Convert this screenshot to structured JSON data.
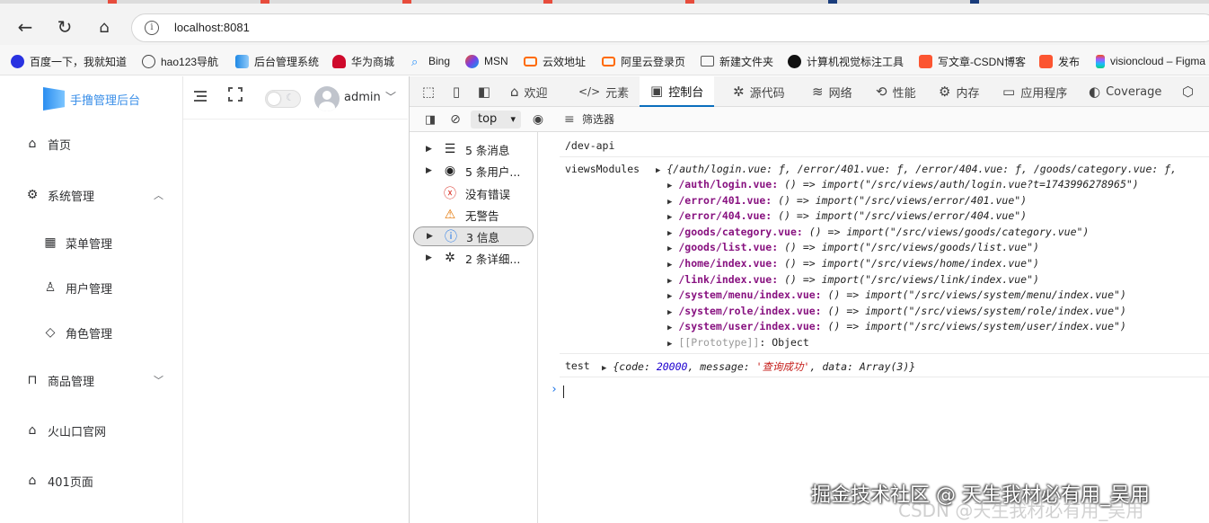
{
  "browser": {
    "url": "localhost:8081",
    "bookmarks": [
      {
        "label": "百度一下，我就知道",
        "color": "#2932e1"
      },
      {
        "label": "hao123导航",
        "color": "#444444"
      },
      {
        "label": "后台管理系统",
        "color": "#1e88e5"
      },
      {
        "label": "华为商城",
        "color": "#cf0a2c"
      },
      {
        "label": "Bing",
        "color": "#258ffa"
      },
      {
        "label": "MSN",
        "color": "#7b3fe4"
      },
      {
        "label": "云效地址",
        "color": "#ff6a00"
      },
      {
        "label": "阿里云登录页",
        "color": "#ff6a00"
      },
      {
        "label": "新建文件夹",
        "color": "#555555"
      },
      {
        "label": "计算机视觉标注工具",
        "color": "#111111"
      },
      {
        "label": "写文章-CSDN博客",
        "color": "#fc5531"
      },
      {
        "label": "发布",
        "color": "#fc5531"
      },
      {
        "label": "visioncloud – Figma",
        "color": "#a259ff"
      }
    ]
  },
  "app": {
    "logo_text": "手撸管理后台",
    "user_name": "admin",
    "menu": [
      {
        "label": "首页",
        "icon": "home-icon"
      },
      {
        "label": "系统管理",
        "icon": "gear-icon",
        "arrow": "︿"
      },
      {
        "label": "菜单管理",
        "icon": "grid-icon"
      },
      {
        "label": "用户管理",
        "icon": "user-icon"
      },
      {
        "label": "角色管理",
        "icon": "role-icon"
      },
      {
        "label": "商品管理",
        "icon": "bag-icon",
        "arrow": "﹀"
      },
      {
        "label": "火山口官网",
        "icon": "home-icon"
      },
      {
        "label": "401页面",
        "icon": "home-icon"
      }
    ]
  },
  "devtools": {
    "tabs": [
      {
        "label": "欢迎",
        "icon": "⌂"
      },
      {
        "label": "元素",
        "icon": "</>"
      },
      {
        "label": "控制台",
        "icon": "▣"
      },
      {
        "label": "源代码",
        "icon": "✲"
      },
      {
        "label": "网络",
        "icon": "≋"
      },
      {
        "label": "性能",
        "icon": "⟲"
      },
      {
        "label": "内存",
        "icon": "⚙"
      },
      {
        "label": "应用程序",
        "icon": "▭"
      },
      {
        "label": "Coverage",
        "icon": "◐"
      },
      {
        "label": "",
        "icon": "⬡"
      }
    ],
    "context": "top",
    "filter_placeholder": "筛选器",
    "sidebar": [
      {
        "label": "5 条消息",
        "icon": "list-icon"
      },
      {
        "label": "5 条用户...",
        "icon": "user-circle-icon"
      },
      {
        "label": "没有错误",
        "icon": "error-icon"
      },
      {
        "label": "无警告",
        "icon": "warning-icon"
      },
      {
        "label": "3 信息",
        "icon": "info-icon"
      },
      {
        "label": "2 条详细...",
        "icon": "bug-icon"
      }
    ],
    "console": {
      "line1": "/dev-api",
      "views_label": "viewsModules",
      "views_summary": "{/auth/login.vue: ƒ, /error/401.vue: ƒ, /error/404.vue: ƒ, /goods/category.vue: ƒ,",
      "entries": [
        {
          "key": "/auth/login.vue:",
          "val": "() => import(\"/src/views/auth/login.vue?t=1743996278965\")"
        },
        {
          "key": "/error/401.vue:",
          "val": "() => import(\"/src/views/error/401.vue\")"
        },
        {
          "key": "/error/404.vue:",
          "val": "() => import(\"/src/views/error/404.vue\")"
        },
        {
          "key": "/goods/category.vue:",
          "val": "() => import(\"/src/views/goods/category.vue\")"
        },
        {
          "key": "/goods/list.vue:",
          "val": "() => import(\"/src/views/goods/list.vue\")"
        },
        {
          "key": "/home/index.vue:",
          "val": "() => import(\"/src/views/home/index.vue\")"
        },
        {
          "key": "/link/index.vue:",
          "val": "() => import(\"/src/views/link/index.vue\")"
        },
        {
          "key": "/system/menu/index.vue:",
          "val": "() => import(\"/src/views/system/menu/index.vue\")"
        },
        {
          "key": "/system/role/index.vue:",
          "val": "() => import(\"/src/views/system/role/index.vue\")"
        },
        {
          "key": "/system/user/index.vue:",
          "val": "() => import(\"/src/views/system/user/index.vue\")"
        }
      ],
      "proto_key": "[[Prototype]]",
      "proto_val": ": Object",
      "test_label": "test",
      "test_open": "{code: ",
      "test_code": "20000",
      "test_mid": ", message: ",
      "test_msg": "'查询成功'",
      "test_data": ", data: Array(3)}"
    }
  },
  "watermark": "掘金技术社区 @ 天生我材必有用_吴用",
  "watermark2": "CSDN @天生我材必有用_吴用"
}
